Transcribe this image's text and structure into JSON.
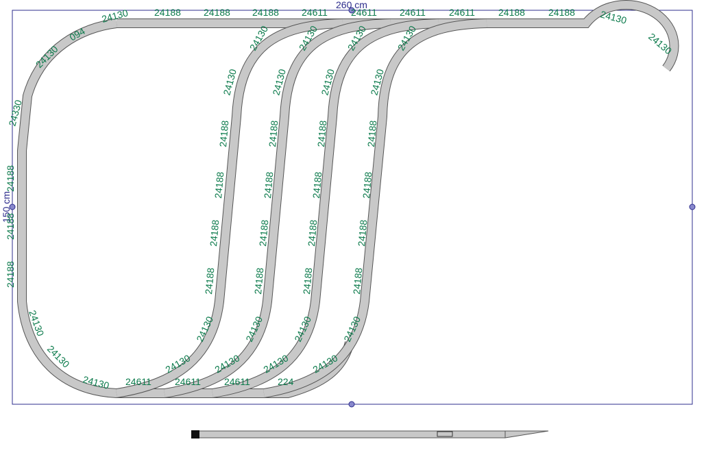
{
  "board": {
    "width_label": "260 cm",
    "height_label": "150 cm",
    "frame_color": "#2c2c8c",
    "label_color": "#0b7a4b",
    "rail_color": "#c8c8c8"
  },
  "labels": {
    "top1": "24188",
    "top2": "24188",
    "top3": "24188",
    "top4": "24611",
    "top5": "24611",
    "top6": "24611",
    "top7": "24611",
    "top8": "24188",
    "top9": "24188",
    "tl_curve1": "24130",
    "tl_curve2": "094",
    "tl_curve3": "24130",
    "tl_curve4": "24330",
    "tr_curve1": "24130",
    "tr_curve2": "24130",
    "left1": "24188",
    "left2": "24188",
    "left3": "24188",
    "bl_curve1": "24130",
    "bl_curve2": "24130",
    "bl_curve3": "24130",
    "bottom1": "24611",
    "bottom2": "24611",
    "bottom3": "24611",
    "bottom4": "224",
    "s1_top": "24130",
    "s1_a": "24130",
    "s1_b": "24188",
    "s1_c": "24188",
    "s1_d": "24188",
    "s1_e": "24188",
    "s1_bot": "24130",
    "s1_bot2": "24130",
    "s2_top": "24130",
    "s2_a": "24130",
    "s2_b": "24188",
    "s2_c": "24188",
    "s2_d": "24188",
    "s2_e": "24188",
    "s2_bot": "24130",
    "s2_bot2": "24130",
    "s3_top": "24130",
    "s3_a": "24130",
    "s3_b": "24188",
    "s3_c": "24188",
    "s3_d": "24188",
    "s3_e": "24188",
    "s3_bot": "24130",
    "s3_bot2": "24130",
    "s4_top": "24130",
    "s4_a": "24130",
    "s4_b": "24188",
    "s4_c": "24188",
    "s4_d": "24188",
    "s4_e": "24188",
    "s4_bot": "24130",
    "s4_bot2": "24130"
  }
}
